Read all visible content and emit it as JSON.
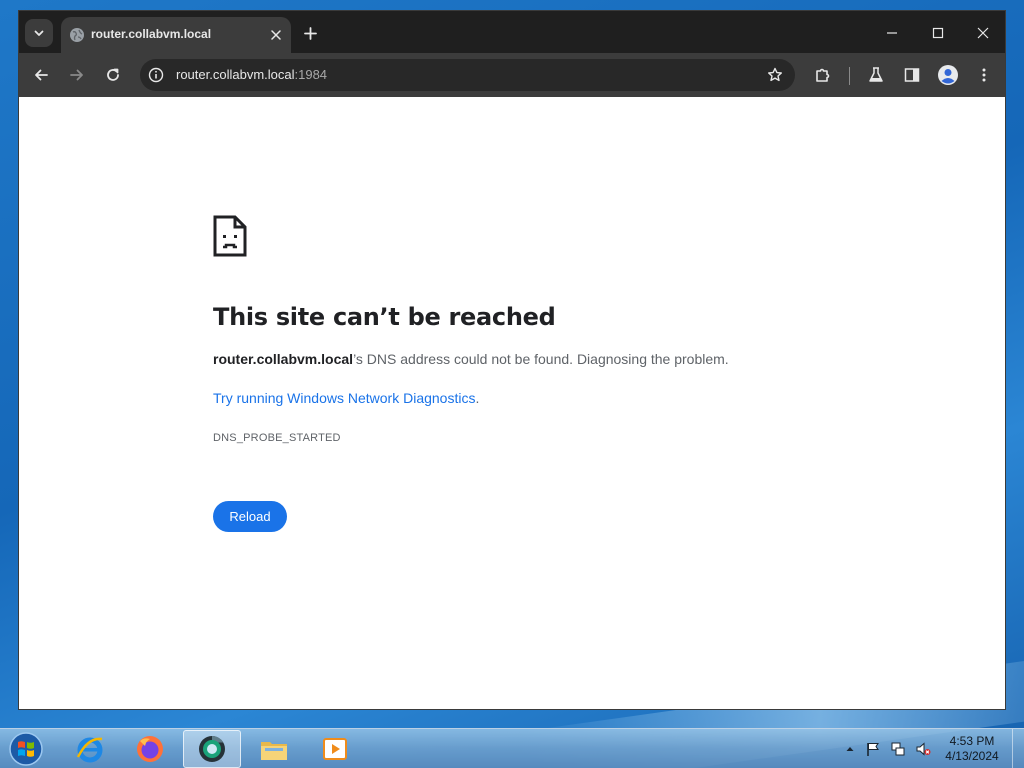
{
  "browser": {
    "tab": {
      "title": "router.collabvm.local"
    },
    "address": {
      "host": "router.collabvm.local",
      "port": ":1984"
    }
  },
  "error_page": {
    "title": "This site can’t be reached",
    "host": "router.collabvm.local",
    "message": "’s DNS address could not be found. Diagnosing the problem.",
    "link_text": "Try running Windows Network Diagnostics",
    "link_suffix": ".",
    "error_code": "DNS_PROBE_STARTED",
    "reload_label": "Reload"
  },
  "taskbar": {
    "apps": [
      "internet-explorer-icon",
      "firefox-icon",
      "chrome-dev-icon",
      "file-explorer-icon",
      "media-player-icon"
    ],
    "active_app": "chrome-dev-icon",
    "clock": {
      "time": "4:53 PM",
      "date": "4/13/2024"
    }
  },
  "colors": {
    "accent": "#1a73e8",
    "tab_strip": "#1f1f1f",
    "toolbar": "#3c3c3c"
  }
}
